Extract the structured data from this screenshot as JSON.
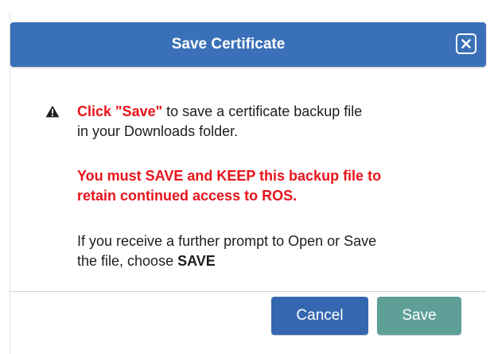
{
  "dialog": {
    "title": "Save Certificate",
    "close_icon": "close-icon",
    "warning_icon": "warning-triangle-icon",
    "warning_highlight": "Click \"Save\"",
    "warning_line1_rest": " to save a certificate backup file",
    "warning_line2": "in your Downloads folder.",
    "notice_line1": "You must SAVE and KEEP this backup file to",
    "notice_line2": "retain continued access to ROS.",
    "prompt_line1": "If you receive a further prompt to Open or Save",
    "prompt_line2_start": "the file, choose ",
    "prompt_line2_bold": "SAVE",
    "buttons": {
      "cancel": "Cancel",
      "save": "Save"
    }
  },
  "colors": {
    "titlebar": "#3a70b7",
    "alert_red": "#e8131b",
    "cancel_button": "#3567b0",
    "save_button": "#5e9f98"
  }
}
